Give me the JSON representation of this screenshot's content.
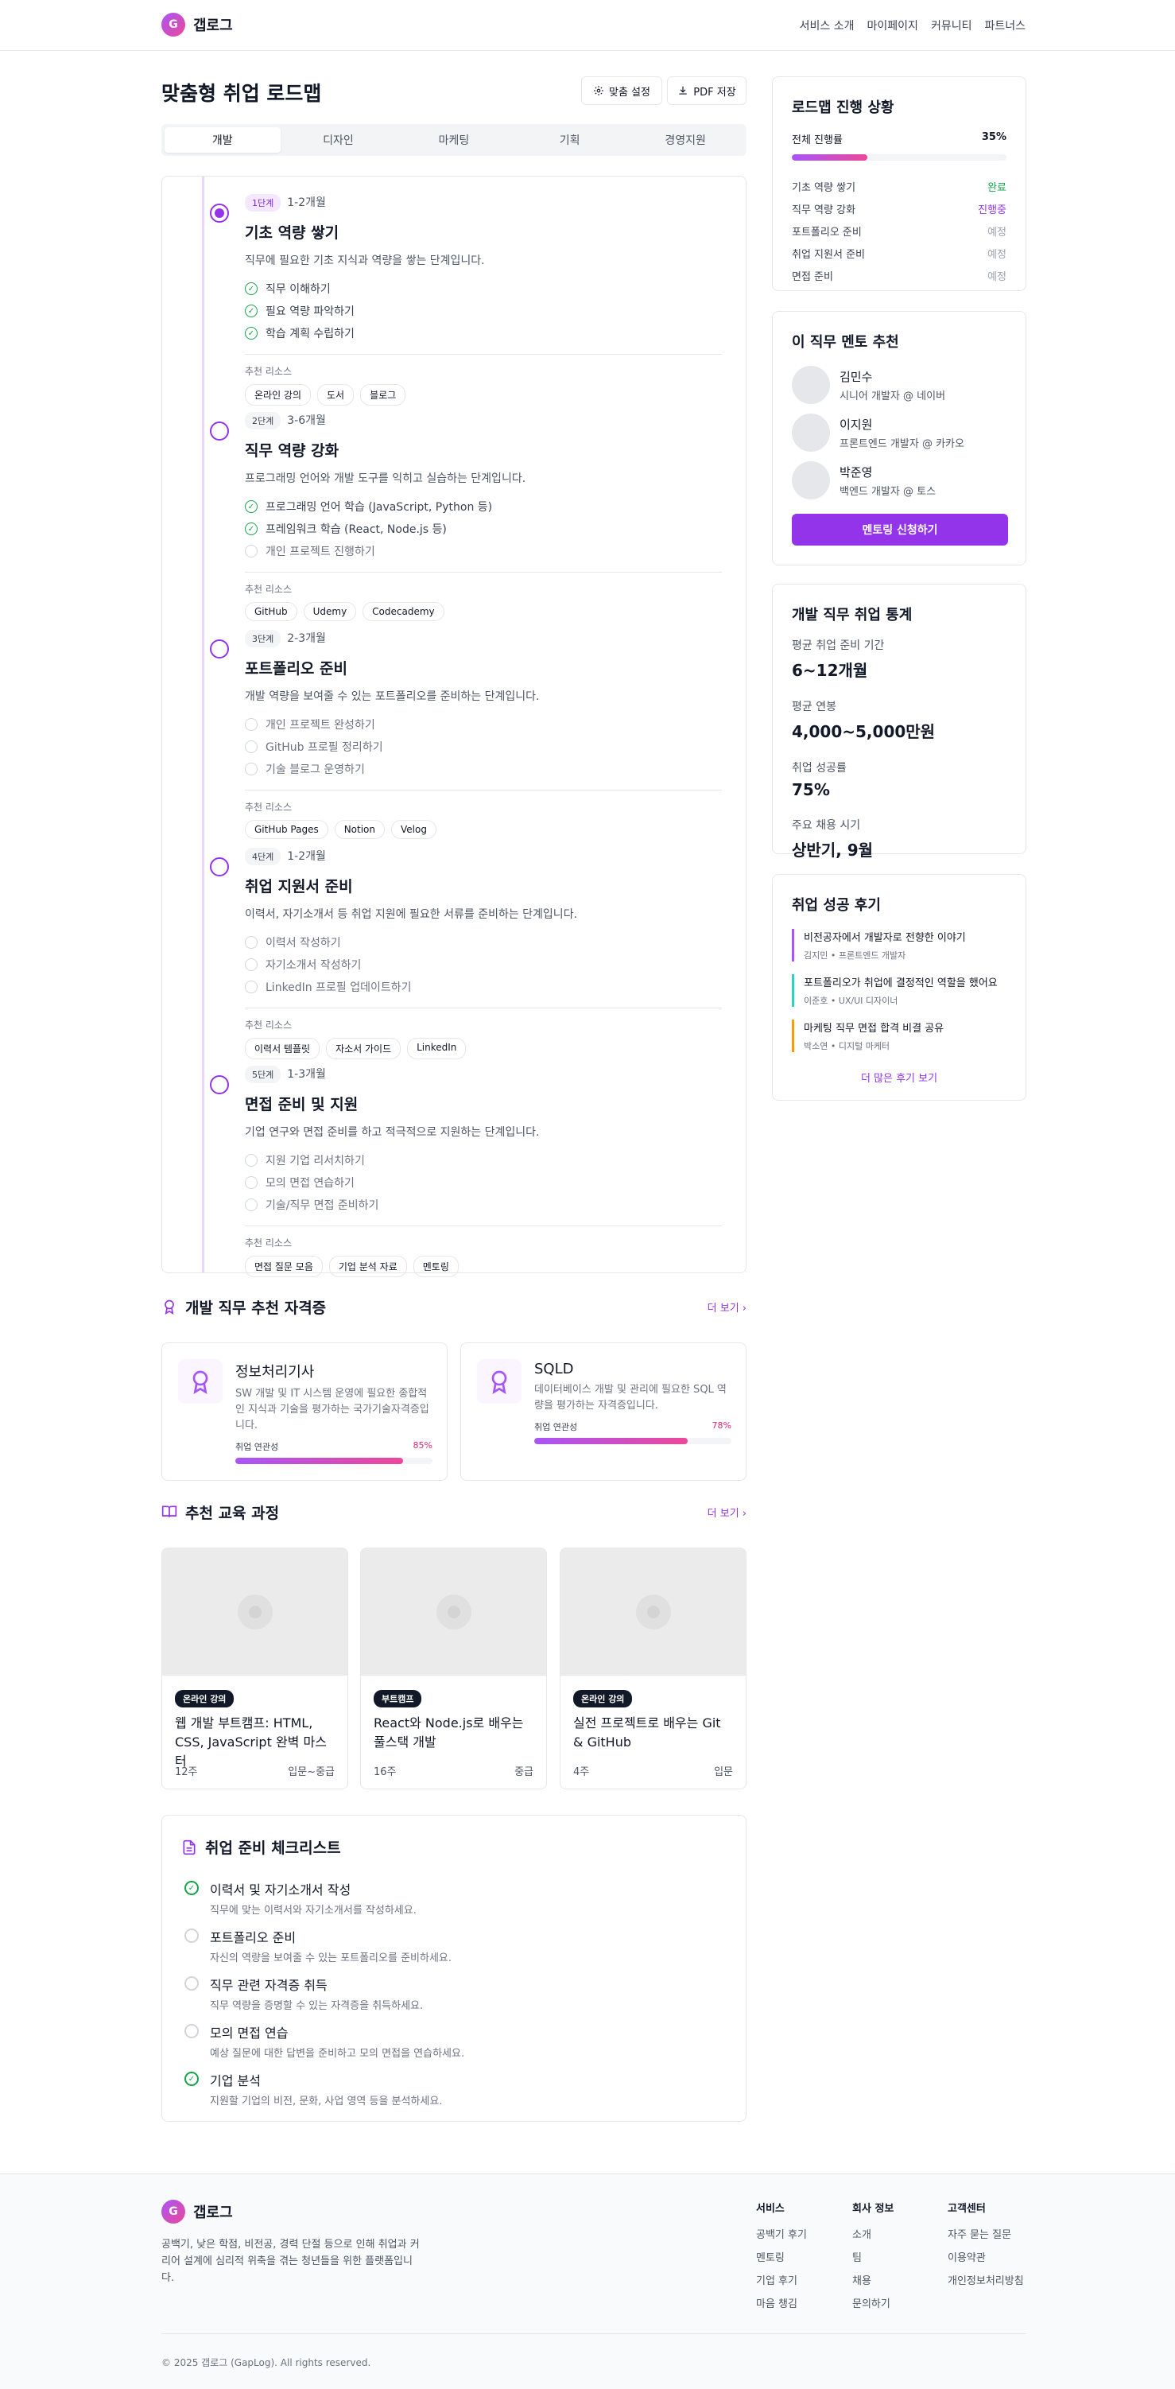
{
  "header": {
    "logo_letter": "G",
    "logo_text": "갭로그",
    "nav": [
      "서비스 소개",
      "마이페이지",
      "커뮤니티",
      "파트너스"
    ]
  },
  "page": {
    "title": "맞춤형 취업 로드맵",
    "settings_button": "맞춤 설정",
    "pdf_button": "PDF 저장"
  },
  "tabs": [
    "개발",
    "디자인",
    "마케팅",
    "기획",
    "경영지원"
  ],
  "active_tab": "개발",
  "roadmap": {
    "resource_label": "추천 리소스",
    "stages": [
      {
        "badge": "1단계",
        "duration": "1-2개월",
        "title": "기초 역량 쌓기",
        "desc": "직무에 필요한 기초 지식과 역량을 쌓는 단계입니다.",
        "tasks": [
          {
            "text": "직무 이해하기",
            "done": true
          },
          {
            "text": "필요 역량 파악하기",
            "done": true
          },
          {
            "text": "학습 계획 수립하기",
            "done": true
          }
        ],
        "resources": [
          "온라인 강의",
          "도서",
          "블로그"
        ]
      },
      {
        "badge": "2단계",
        "duration": "3-6개월",
        "title": "직무 역량 강화",
        "desc": "프로그래밍 언어와 개발 도구를 익히고 실습하는 단계입니다.",
        "tasks": [
          {
            "text": "프로그래밍 언어 학습 (JavaScript, Python 등)",
            "done": true
          },
          {
            "text": "프레임워크 학습 (React, Node.js 등)",
            "done": true
          },
          {
            "text": "개인 프로젝트 진행하기",
            "done": false
          }
        ],
        "resources": [
          "GitHub",
          "Udemy",
          "Codecademy"
        ]
      },
      {
        "badge": "3단계",
        "duration": "2-3개월",
        "title": "포트폴리오 준비",
        "desc": "개발 역량을 보여줄 수 있는 포트폴리오를 준비하는 단계입니다.",
        "tasks": [
          {
            "text": "개인 프로젝트 완성하기",
            "done": false
          },
          {
            "text": "GitHub 프로필 정리하기",
            "done": false
          },
          {
            "text": "기술 블로그 운영하기",
            "done": false
          }
        ],
        "resources": [
          "GitHub Pages",
          "Notion",
          "Velog"
        ]
      },
      {
        "badge": "4단계",
        "duration": "1-2개월",
        "title": "취업 지원서 준비",
        "desc": "이력서, 자기소개서 등 취업 지원에 필요한 서류를 준비하는 단계입니다.",
        "tasks": [
          {
            "text": "이력서 작성하기",
            "done": false
          },
          {
            "text": "자기소개서 작성하기",
            "done": false
          },
          {
            "text": "LinkedIn 프로필 업데이트하기",
            "done": false
          }
        ],
        "resources": [
          "이력서 템플릿",
          "자소서 가이드",
          "LinkedIn"
        ]
      },
      {
        "badge": "5단계",
        "duration": "1-3개월",
        "title": "면접 준비 및 지원",
        "desc": "기업 연구와 면접 준비를 하고 적극적으로 지원하는 단계입니다.",
        "tasks": [
          {
            "text": "지원 기업 리서치하기",
            "done": false
          },
          {
            "text": "모의 면접 연습하기",
            "done": false
          },
          {
            "text": "기술/직무 면접 준비하기",
            "done": false
          }
        ],
        "resources": [
          "면접 질문 모음",
          "기업 분석 자료",
          "멘토링"
        ]
      }
    ]
  },
  "certs": {
    "title": "개발 직무 추천 자격증",
    "more": "더 보기",
    "relevance_label": "취업 연관성",
    "items": [
      {
        "name": "정보처리기사",
        "desc": "SW 개발 및 IT 시스템 운영에 필요한 종합적인 지식과 기술을 평가하는 국가기술자격증입니다.",
        "relevance": 85,
        "relevance_text": "85%"
      },
      {
        "name": "SQLD",
        "desc": "데이터베이스 개발 및 관리에 필요한 SQL 역량을 평가하는 자격증입니다.",
        "relevance": 78,
        "relevance_text": "78%"
      }
    ]
  },
  "courses": {
    "title": "추천 교육 과정",
    "more": "더 보기",
    "items": [
      {
        "type": "온라인 강의",
        "title": "웹 개발 부트캠프: HTML, CSS, JavaScript 완벽 마스터",
        "duration": "12주",
        "level": "입문~중급"
      },
      {
        "type": "부트캠프",
        "title": "React와 Node.js로 배우는 풀스택 개발",
        "duration": "16주",
        "level": "중급"
      },
      {
        "type": "온라인 강의",
        "title": "실전 프로젝트로 배우는 Git & GitHub",
        "duration": "4주",
        "level": "입문"
      }
    ]
  },
  "checklist": {
    "title": "취업 준비 체크리스트",
    "items": [
      {
        "title": "이력서 및 자기소개서 작성",
        "desc": "직무에 맞는 이력서와 자기소개서를 작성하세요.",
        "done": true
      },
      {
        "title": "포트폴리오 준비",
        "desc": "자신의 역량을 보여줄 수 있는 포트폴리오를 준비하세요.",
        "done": false
      },
      {
        "title": "직무 관련 자격증 취득",
        "desc": "직무 역량을 증명할 수 있는 자격증을 취득하세요.",
        "done": false
      },
      {
        "title": "모의 면접 연습",
        "desc": "예상 질문에 대한 답변을 준비하고 모의 면접을 연습하세요.",
        "done": false
      },
      {
        "title": "기업 분석",
        "desc": "지원할 기업의 비전, 문화, 사업 영역 등을 분석하세요.",
        "done": true
      }
    ]
  },
  "progress": {
    "title": "로드맵 진행 상황",
    "overall_label": "전체 진행률",
    "overall_value": 35,
    "overall_text": "35%",
    "stages": [
      {
        "name": "기초 역량 쌓기",
        "status": "완료",
        "color": "#16a34a"
      },
      {
        "name": "직무 역량 강화",
        "status": "진행중",
        "color": "#9333ea"
      },
      {
        "name": "포트폴리오 준비",
        "status": "예정",
        "color": "#9ca3af"
      },
      {
        "name": "취업 지원서 준비",
        "status": "예정",
        "color": "#9ca3af"
      },
      {
        "name": "면접 준비",
        "status": "예정",
        "color": "#9ca3af"
      }
    ]
  },
  "mentors": {
    "title": "이 직무 멘토 추천",
    "button": "멘토링 신청하기",
    "items": [
      {
        "name": "김민수",
        "role": "시니어 개발자 @ 네이버"
      },
      {
        "name": "이지원",
        "role": "프론트엔드 개발자 @ 카카오"
      },
      {
        "name": "박준영",
        "role": "백엔드 개발자 @ 토스"
      }
    ]
  },
  "stats": {
    "title": "개발 직무 취업 통계",
    "items": [
      {
        "label": "평균 취업 준비 기간",
        "value": "6~12개월"
      },
      {
        "label": "평균 연봉",
        "value": "4,000~5,000만원"
      },
      {
        "label": "취업 성공률",
        "value": "75%"
      },
      {
        "label": "주요 채용 시기",
        "value": "상반기, 9월"
      }
    ]
  },
  "reviews": {
    "title": "취업 성공 후기",
    "more": "더 많은 후기 보기",
    "items": [
      {
        "title": "비전공자에서 개발자로 전향한 이야기",
        "author": "김지민 • 프론트엔드 개발자",
        "color": "#a855f7"
      },
      {
        "title": "포트폴리오가 취업에 결정적인 역할을 했어요",
        "author": "이준호 • UX/UI 디자이너",
        "color": "#2dd4bf"
      },
      {
        "title": "마케팅 직무 면접 합격 비결 공유",
        "author": "박소연 • 디지털 마케터",
        "color": "#f59e0b"
      }
    ]
  },
  "footer": {
    "logo_letter": "G",
    "logo_text": "갭로그",
    "desc": "공백기, 낮은 학점, 비전공, 경력 단절 등으로 인해 취업과 커리어 설계에 심리적 위축을 겪는 청년들을 위한 플랫폼입니다.",
    "columns": [
      {
        "title": "서비스",
        "links": [
          "공백기 후기",
          "멘토링",
          "기업 후기",
          "마음 챙김"
        ]
      },
      {
        "title": "회사 정보",
        "links": [
          "소개",
          "팀",
          "채용",
          "문의하기"
        ]
      },
      {
        "title": "고객센터",
        "links": [
          "자주 묻는 질문",
          "이용약관",
          "개인정보처리방침"
        ]
      }
    ],
    "copyright": "© 2025 갭로그 (GapLog). All rights reserved."
  },
  "colors": {
    "accent": "#9333ea",
    "pink": "#ec4899",
    "success": "#16a34a"
  }
}
